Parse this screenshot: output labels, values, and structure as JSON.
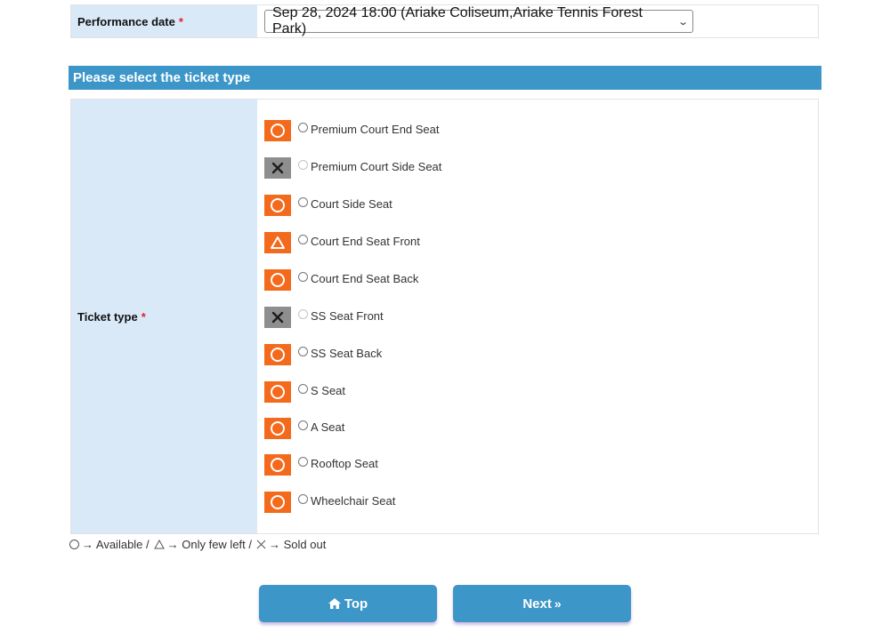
{
  "performance_date": {
    "label": "Performance date",
    "required_mark": "*",
    "selected": "Sep 28, 2024 18:00 (Ariake Coliseum,Ariake Tennis Forest Park)"
  },
  "section_title": "Please select the ticket type",
  "ticket_type": {
    "label": "Ticket type",
    "required_mark": "*",
    "options": [
      {
        "label": "Premium Court End Seat",
        "status": "available",
        "icon": "circle-icon"
      },
      {
        "label": "Premium Court Side Seat",
        "status": "sold_out",
        "icon": "cross-icon"
      },
      {
        "label": "Court Side Seat",
        "status": "available",
        "icon": "circle-icon"
      },
      {
        "label": "Court End Seat Front",
        "status": "few_left",
        "icon": "triangle-icon"
      },
      {
        "label": "Court End Seat Back",
        "status": "available",
        "icon": "circle-icon"
      },
      {
        "label": "SS Seat Front",
        "status": "sold_out",
        "icon": "cross-icon"
      },
      {
        "label": "SS Seat Back",
        "status": "available",
        "icon": "circle-icon"
      },
      {
        "label": "S Seat",
        "status": "available",
        "icon": "circle-icon"
      },
      {
        "label": "A Seat",
        "status": "available",
        "icon": "circle-icon"
      },
      {
        "label": "Rooftop Seat",
        "status": "available",
        "icon": "circle-icon"
      },
      {
        "label": "Wheelchair Seat",
        "status": "available",
        "icon": "circle-icon"
      }
    ]
  },
  "legend": {
    "available_text": "→ Available /",
    "few_left_text": "→ Only few left /",
    "sold_out_text": "→ Sold out"
  },
  "buttons": {
    "top_label": "Top",
    "next_label": "Next"
  },
  "colors": {
    "accent": "#3d96c8",
    "label_bg": "#d9e9f7",
    "available": "#f46a1c",
    "sold_out": "#8e8e8e",
    "required": "#e0212f"
  }
}
